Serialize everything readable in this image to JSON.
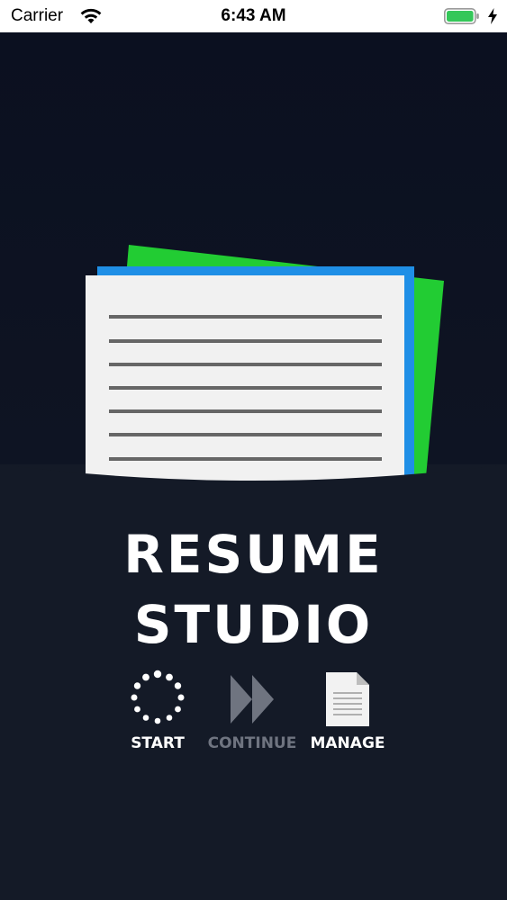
{
  "status_bar": {
    "carrier": "Carrier",
    "time": "6:43 AM",
    "wifi_icon": "wifi-icon",
    "battery_icon": "battery-icon",
    "charging_icon": "charging-bolt-icon"
  },
  "app": {
    "title_line1": "RESUME",
    "title_line2": "STUDIO",
    "logo_icon": "document-stack-icon"
  },
  "menu": {
    "start": {
      "label": "START",
      "icon": "spinner-dots-icon",
      "enabled": true
    },
    "continue": {
      "label": "CONTINUE",
      "icon": "fast-forward-icon",
      "enabled": false
    },
    "manage": {
      "label": "MANAGE",
      "icon": "document-icon",
      "enabled": true
    }
  },
  "colors": {
    "background": "#0d1220",
    "pocket": "#141a27",
    "paper_green": "#22cc33",
    "paper_blue": "#1f8fe6",
    "paper_white": "#f2f2f2",
    "text_white": "#ffffff",
    "text_disabled": "#6f7480"
  }
}
